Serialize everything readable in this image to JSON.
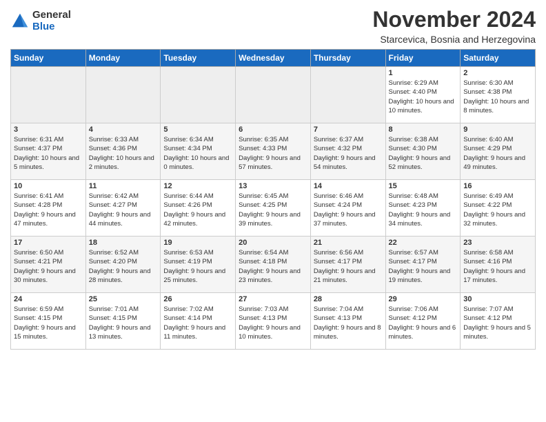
{
  "logo": {
    "general": "General",
    "blue": "Blue"
  },
  "title": "November 2024",
  "subtitle": "Starcevica, Bosnia and Herzegovina",
  "days_header": [
    "Sunday",
    "Monday",
    "Tuesday",
    "Wednesday",
    "Thursday",
    "Friday",
    "Saturday"
  ],
  "weeks": [
    [
      {
        "day": "",
        "info": ""
      },
      {
        "day": "",
        "info": ""
      },
      {
        "day": "",
        "info": ""
      },
      {
        "day": "",
        "info": ""
      },
      {
        "day": "",
        "info": ""
      },
      {
        "day": "1",
        "info": "Sunrise: 6:29 AM\nSunset: 4:40 PM\nDaylight: 10 hours and 10 minutes."
      },
      {
        "day": "2",
        "info": "Sunrise: 6:30 AM\nSunset: 4:38 PM\nDaylight: 10 hours and 8 minutes."
      }
    ],
    [
      {
        "day": "3",
        "info": "Sunrise: 6:31 AM\nSunset: 4:37 PM\nDaylight: 10 hours and 5 minutes."
      },
      {
        "day": "4",
        "info": "Sunrise: 6:33 AM\nSunset: 4:36 PM\nDaylight: 10 hours and 2 minutes."
      },
      {
        "day": "5",
        "info": "Sunrise: 6:34 AM\nSunset: 4:34 PM\nDaylight: 10 hours and 0 minutes."
      },
      {
        "day": "6",
        "info": "Sunrise: 6:35 AM\nSunset: 4:33 PM\nDaylight: 9 hours and 57 minutes."
      },
      {
        "day": "7",
        "info": "Sunrise: 6:37 AM\nSunset: 4:32 PM\nDaylight: 9 hours and 54 minutes."
      },
      {
        "day": "8",
        "info": "Sunrise: 6:38 AM\nSunset: 4:30 PM\nDaylight: 9 hours and 52 minutes."
      },
      {
        "day": "9",
        "info": "Sunrise: 6:40 AM\nSunset: 4:29 PM\nDaylight: 9 hours and 49 minutes."
      }
    ],
    [
      {
        "day": "10",
        "info": "Sunrise: 6:41 AM\nSunset: 4:28 PM\nDaylight: 9 hours and 47 minutes."
      },
      {
        "day": "11",
        "info": "Sunrise: 6:42 AM\nSunset: 4:27 PM\nDaylight: 9 hours and 44 minutes."
      },
      {
        "day": "12",
        "info": "Sunrise: 6:44 AM\nSunset: 4:26 PM\nDaylight: 9 hours and 42 minutes."
      },
      {
        "day": "13",
        "info": "Sunrise: 6:45 AM\nSunset: 4:25 PM\nDaylight: 9 hours and 39 minutes."
      },
      {
        "day": "14",
        "info": "Sunrise: 6:46 AM\nSunset: 4:24 PM\nDaylight: 9 hours and 37 minutes."
      },
      {
        "day": "15",
        "info": "Sunrise: 6:48 AM\nSunset: 4:23 PM\nDaylight: 9 hours and 34 minutes."
      },
      {
        "day": "16",
        "info": "Sunrise: 6:49 AM\nSunset: 4:22 PM\nDaylight: 9 hours and 32 minutes."
      }
    ],
    [
      {
        "day": "17",
        "info": "Sunrise: 6:50 AM\nSunset: 4:21 PM\nDaylight: 9 hours and 30 minutes."
      },
      {
        "day": "18",
        "info": "Sunrise: 6:52 AM\nSunset: 4:20 PM\nDaylight: 9 hours and 28 minutes."
      },
      {
        "day": "19",
        "info": "Sunrise: 6:53 AM\nSunset: 4:19 PM\nDaylight: 9 hours and 25 minutes."
      },
      {
        "day": "20",
        "info": "Sunrise: 6:54 AM\nSunset: 4:18 PM\nDaylight: 9 hours and 23 minutes."
      },
      {
        "day": "21",
        "info": "Sunrise: 6:56 AM\nSunset: 4:17 PM\nDaylight: 9 hours and 21 minutes."
      },
      {
        "day": "22",
        "info": "Sunrise: 6:57 AM\nSunset: 4:17 PM\nDaylight: 9 hours and 19 minutes."
      },
      {
        "day": "23",
        "info": "Sunrise: 6:58 AM\nSunset: 4:16 PM\nDaylight: 9 hours and 17 minutes."
      }
    ],
    [
      {
        "day": "24",
        "info": "Sunrise: 6:59 AM\nSunset: 4:15 PM\nDaylight: 9 hours and 15 minutes."
      },
      {
        "day": "25",
        "info": "Sunrise: 7:01 AM\nSunset: 4:15 PM\nDaylight: 9 hours and 13 minutes."
      },
      {
        "day": "26",
        "info": "Sunrise: 7:02 AM\nSunset: 4:14 PM\nDaylight: 9 hours and 11 minutes."
      },
      {
        "day": "27",
        "info": "Sunrise: 7:03 AM\nSunset: 4:13 PM\nDaylight: 9 hours and 10 minutes."
      },
      {
        "day": "28",
        "info": "Sunrise: 7:04 AM\nSunset: 4:13 PM\nDaylight: 9 hours and 8 minutes."
      },
      {
        "day": "29",
        "info": "Sunrise: 7:06 AM\nSunset: 4:12 PM\nDaylight: 9 hours and 6 minutes."
      },
      {
        "day": "30",
        "info": "Sunrise: 7:07 AM\nSunset: 4:12 PM\nDaylight: 9 hours and 5 minutes."
      }
    ]
  ]
}
